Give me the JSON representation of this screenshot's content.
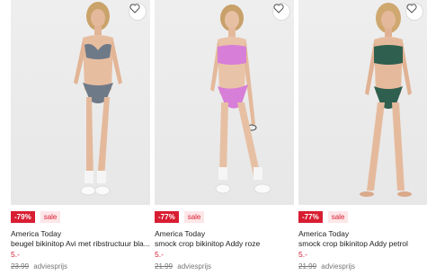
{
  "products": [
    {
      "discount": "-79%",
      "sale_label": "sale",
      "brand": "America Today",
      "title": "beugel bikinitop Avi met ribstructuur bla...",
      "price": "5.-",
      "old_price": "23.99",
      "old_price_label": "adviesprijs",
      "swimsuit_color": "#6f7a88"
    },
    {
      "discount": "-77%",
      "sale_label": "sale",
      "brand": "America Today",
      "title": "smock crop bikinitop Addy roze",
      "price": "5.-",
      "old_price": "21.99",
      "old_price_label": "adviesprijs",
      "swimsuit_color": "#d77ed8"
    },
    {
      "discount": "-77%",
      "sale_label": "sale",
      "brand": "America Today",
      "title": "smock crop bikinitop Addy petrol",
      "price": "5.-",
      "old_price": "21.99",
      "old_price_label": "adviesprijs",
      "swimsuit_color": "#2f5f4f"
    }
  ],
  "icons": {
    "wishlist": "heart-outline-icon"
  },
  "colors": {
    "accent": "#d81e32",
    "sale_bg": "#fde6e8",
    "photo_bg": "#eeeeee"
  }
}
